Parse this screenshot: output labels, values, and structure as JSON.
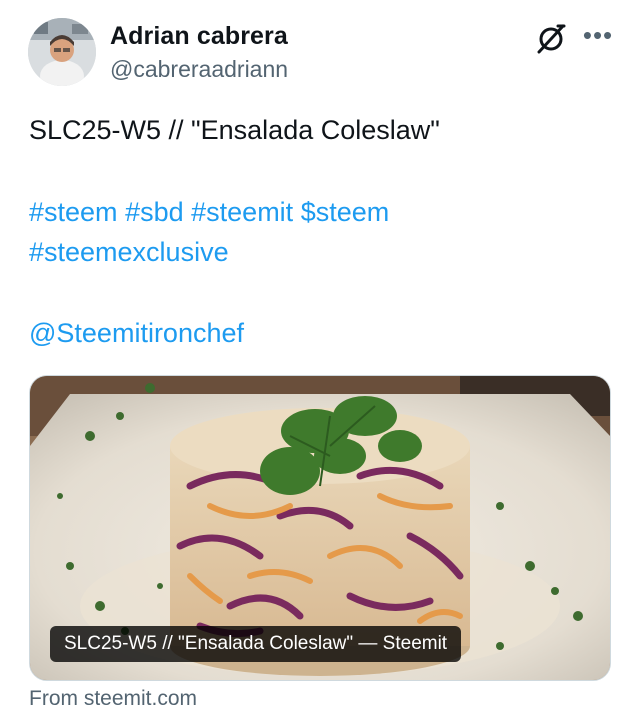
{
  "author": {
    "display_name": "Adrian cabrera",
    "handle": "@cabreraadriann"
  },
  "post": {
    "text": "SLC25-W5 // \"Ensalada Coleslaw\"",
    "hashtags_line1": [
      "#steem",
      "#sbd",
      "#steemit",
      "$steem"
    ],
    "hashtags_line2": [
      "#steemexclusive"
    ],
    "mention": "@Steemitironchef"
  },
  "link_card": {
    "title": "SLC25-W5 // \"Ensalada Coleslaw\" — Steemit",
    "source": "From steemit.com"
  },
  "icons": {
    "grok": "grok-icon",
    "more": "more-options-icon"
  },
  "colors": {
    "link": "#1d9bf0",
    "text": "#0f1419",
    "secondary": "#536471"
  }
}
